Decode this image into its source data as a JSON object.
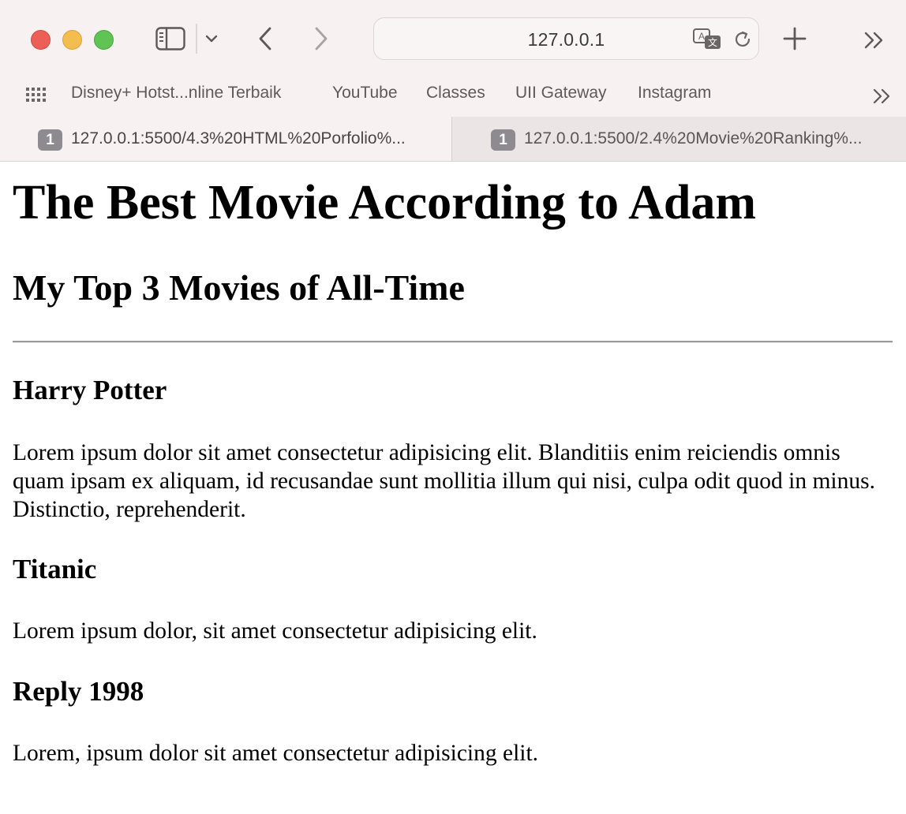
{
  "browser": {
    "address": "127.0.0.1",
    "favorites": [
      {
        "label": "Disney+ Hotst...nline Terbaik"
      },
      {
        "label": "YouTube"
      },
      {
        "label": "Classes"
      },
      {
        "label": "UII Gateway"
      },
      {
        "label": "Instagram"
      }
    ],
    "tabs": [
      {
        "badge": "1",
        "title": "127.0.0.1:5500/4.3%20HTML%20Porfolio%...",
        "active": true
      },
      {
        "badge": "1",
        "title": "127.0.0.1:5500/2.4%20Movie%20Ranking%...",
        "active": false
      }
    ],
    "icons": {
      "sidebar": "sidebar-icon",
      "sidebar_menu": "chevron-down-icon",
      "back": "chevron-left-icon",
      "forward": "chevron-right-icon",
      "translate": "translate-icon",
      "reload": "reload-icon",
      "new_tab": "plus-icon",
      "overflow": "double-chevron-right-icon",
      "grid": "grid-icon"
    },
    "colors": {
      "close": "#ec5f57",
      "minimize": "#f4bd4f",
      "zoom": "#5fc453",
      "chrome_bg": "#f7f1f1"
    }
  },
  "page": {
    "title": "The Best Movie According to Adam",
    "subtitle": "My Top 3 Movies of All-Time",
    "movies": [
      {
        "name": "Harry Potter",
        "description": "Lorem ipsum dolor sit amet consectetur adipisicing elit. Blanditiis enim reiciendis omnis quam ipsam ex aliquam, id recusandae sunt mollitia illum qui nisi, culpa odit quod in minus. Distinctio, reprehenderit."
      },
      {
        "name": "Titanic",
        "description": "Lorem ipsum dolor, sit amet consectetur adipisicing elit."
      },
      {
        "name": "Reply 1998",
        "description": "Lorem, ipsum dolor sit amet consectetur adipisicing elit."
      }
    ]
  }
}
